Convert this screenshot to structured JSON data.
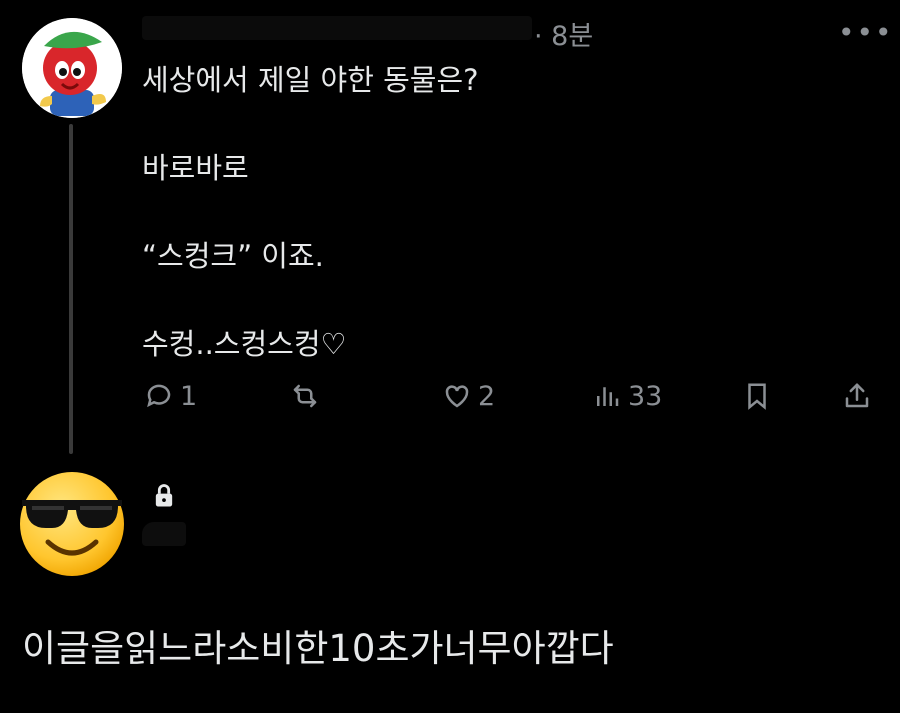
{
  "post": {
    "time": "· 8분",
    "more": "•••",
    "lines": [
      "세상에서 제일 야한 동물은?",
      "바로바로",
      "“스컹크” 이죠.",
      "수컹..스컹스컹♡"
    ],
    "actions": {
      "reply_count": "1",
      "repost_count": "",
      "like_count": "2",
      "view_count": "33"
    }
  },
  "reply": {
    "text": "이글을읽느라소비한10초가너무아깝다"
  },
  "icons": [
    "reply-icon",
    "repost-icon",
    "like-icon",
    "views-icon",
    "bookmark-icon",
    "share-icon",
    "lock-icon"
  ]
}
